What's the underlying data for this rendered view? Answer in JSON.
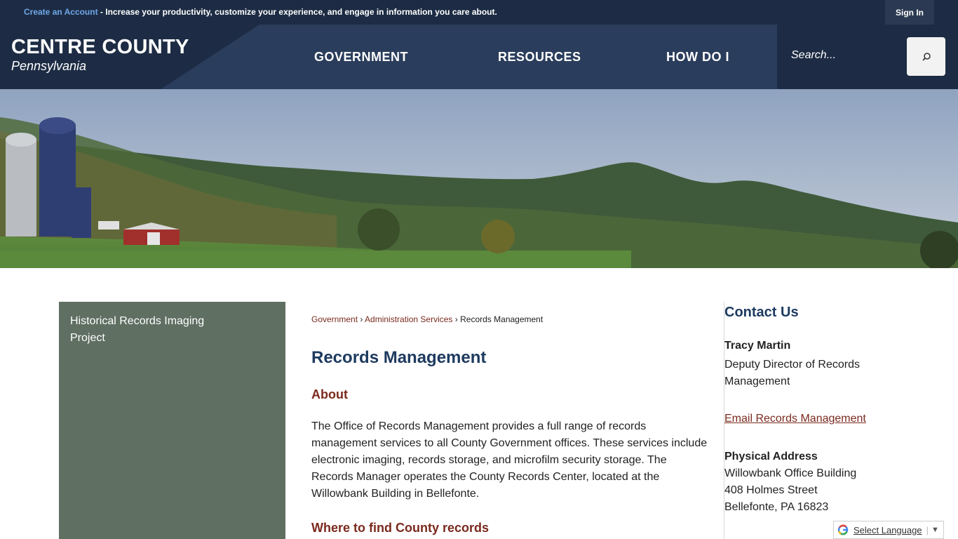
{
  "topbar": {
    "create_account": "Create an Account",
    "promo_text": " - Increase your productivity, customize your experience, and engage in information you care about.",
    "sign_in": "Sign In"
  },
  "header": {
    "logo_title": "CENTRE COUNTY",
    "logo_subtitle": "Pennsylvania",
    "nav": [
      {
        "label": "GOVERNMENT"
      },
      {
        "label": "RESOURCES"
      },
      {
        "label": "HOW DO I"
      }
    ],
    "search": {
      "placeholder": "Search..."
    }
  },
  "sidebar": {
    "items": [
      {
        "label": "Historical Records Imaging Project"
      }
    ]
  },
  "breadcrumb": {
    "items": [
      {
        "label": "Government"
      },
      {
        "label": "Administration Services"
      },
      {
        "label": "Records Management"
      }
    ],
    "separator": "›"
  },
  "main": {
    "title": "Records Management",
    "about_heading": "About",
    "about_text": "The Office of Records Management provides a full range of records management services to all County Government offices. These services include electronic imaging, records storage, and microfilm security storage. The Records Manager operates the County Records Center, located at the Willowbank Building in Bellefonte.",
    "where_heading": "Where to find County records"
  },
  "contact": {
    "title": "Contact Us",
    "name": "Tracy Martin",
    "role": "Deputy Director of Records Management",
    "email_link": "Email Records Management",
    "address_label": "Physical Address",
    "address_lines": [
      "Willowbank Office Building",
      "408 Holmes Street",
      "Bellefonte, PA 16823"
    ]
  },
  "translate": {
    "label": "Select Language"
  },
  "colors": {
    "topbar_bg": "#1d2c44",
    "header_bg": "#2a3d5c",
    "sidebar_bg": "#5f6f62",
    "heading_blue": "#1d3a5f",
    "accent_red": "#7a2a1e",
    "link_blue": "#6fa8e8"
  },
  "icons": {
    "search": "search-icon",
    "google_logo": "google-icon",
    "dropdown": "dropdown-caret-icon"
  }
}
